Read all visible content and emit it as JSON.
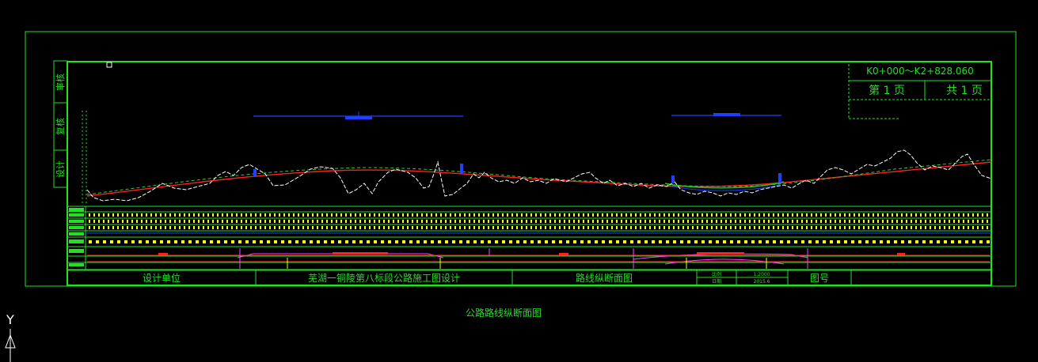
{
  "drawing": {
    "range": "K0+000～K2+828.060",
    "page_current_label": "第 1 页",
    "page_total_label": "共 1 页",
    "side_labels": [
      "审核",
      "复核",
      "设计"
    ],
    "side_label_extra": "设计",
    "title_block": {
      "design_unit": "设计单位",
      "project": "芜湖一铜陵第八标段公路施工图设计",
      "drawing_name": "路线纵断面图",
      "scale_label": "比例",
      "scale_value": "1:2000",
      "date_label": "日期",
      "date_value": "2015.6",
      "drawing_no_label": "图号",
      "drawing_no_value": ""
    },
    "caption": "公路路线纵断面图"
  },
  "ucs": {
    "y_label": "Y"
  },
  "colors": {
    "frame": "#22e022",
    "ground_line": "#ffffff",
    "design_line": "#ff2020",
    "vertical_curve": "#2040ff",
    "grid_marks": "#ffff00",
    "magenta": "#ff40ff"
  }
}
